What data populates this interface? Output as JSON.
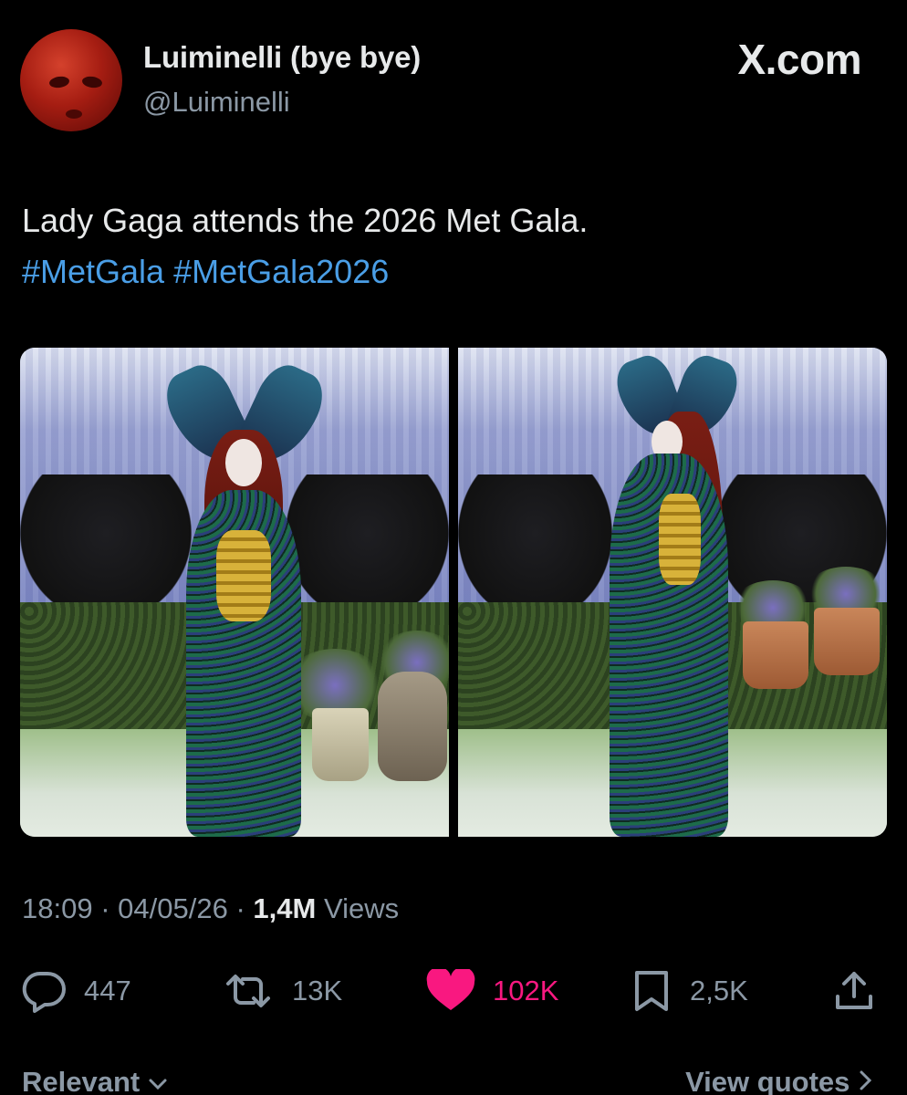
{
  "header": {
    "display_name": "Luiminelli (bye bye)",
    "handle": "@Luiminelli",
    "brand": "X.com",
    "brand_icon": "x-logo-icon"
  },
  "tweet": {
    "text": "Lady Gaga attends the 2026 Met Gala.",
    "hashtags": [
      "#MetGala",
      "#MetGala2026"
    ],
    "hashtag_color": "#4a9ee6"
  },
  "media": {
    "count": 2
  },
  "meta": {
    "time": "18:09",
    "date": "04/05/26",
    "separator": "·",
    "views_count": "1,4M",
    "views_label": "Views"
  },
  "actions": {
    "reply": {
      "icon": "reply-icon",
      "count": "447"
    },
    "repost": {
      "icon": "repost-icon",
      "count": "13K"
    },
    "like": {
      "icon": "heart-icon",
      "count": "102K",
      "color": "#f91880"
    },
    "bookmark": {
      "icon": "bookmark-icon",
      "count": "2,5K"
    },
    "share": {
      "icon": "share-icon"
    }
  },
  "footer": {
    "sort_label": "Relevant",
    "sort_icon": "chevron-down-icon",
    "quotes_label": "View quotes",
    "quotes_icon": "chevron-right-icon"
  }
}
